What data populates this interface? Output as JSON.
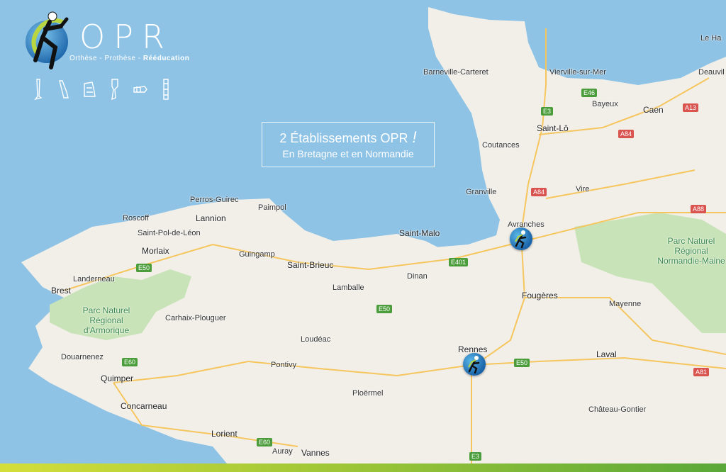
{
  "brand": {
    "name": "OPR",
    "tagline_regular": "Orthèse - Prothèse - ",
    "tagline_bold": "Rééducation",
    "icons": [
      "leg-prosthesis-icon",
      "arm-prosthesis-icon",
      "boot-orthosis-icon",
      "knee-prosthesis-icon",
      "hand-orthosis-icon",
      "splint-icon"
    ]
  },
  "callout": {
    "title": "2 Établissements OPR",
    "exclamation": "!",
    "subtitle": "En Bretagne et en Normandie"
  },
  "places": {
    "barneville": "Barneville-Carteret",
    "vierville": "Vierville-sur-Mer",
    "lehavre": "Le Ha",
    "deauville": "Deauvil",
    "bayeux": "Bayeux",
    "caen": "Caen",
    "saintlo": "Saint-Lô",
    "coutances": "Coutances",
    "granville": "Granville",
    "vire": "Vire",
    "avranches": "Avranches",
    "perros": "Perros-Guirec",
    "lannion": "Lannion",
    "paimpol": "Paimpol",
    "roscoff": "Roscoff",
    "stpol": "Saint-Pol-de-Léon",
    "morlaix": "Morlaix",
    "guingamp": "Guingamp",
    "saintmalo": "Saint-Malo",
    "saintbrieuc": "Saint-Brieuc",
    "landerneau": "Landerneau",
    "brest": "Brest",
    "lamballe": "Lamballe",
    "dinan": "Dinan",
    "fougeres": "Fougères",
    "mayenne": "Mayenne",
    "carhaix": "Carhaix-Plouguer",
    "loudeac": "Loudéac",
    "douarnenez": "Douarnenez",
    "rennes": "Rennes",
    "laval": "Laval",
    "quimper": "Quimper",
    "pontivy": "Pontivy",
    "ploermel": "Ploërmel",
    "concarneau": "Concarneau",
    "chateaugontier": "Château-Gontier",
    "lorient": "Lorient",
    "auray": "Auray",
    "vannes": "Vannes"
  },
  "parks": {
    "armorique": "Parc Naturel Régional d'Armorique",
    "normandie": "Parc Naturel Régional Normandie-Maine"
  },
  "roads": {
    "e46": "E46",
    "e3_north": "E3",
    "a13": "A13",
    "a84_a": "A84",
    "a84_b": "A84",
    "a88": "A88",
    "e50_a": "E50",
    "e401": "E401",
    "e50_b": "E50",
    "e60_a": "E60",
    "e50_c": "E50",
    "a81": "A81",
    "e60_b": "E60",
    "e3_south": "E3"
  },
  "markers": [
    "avranches-opr-marker",
    "rennes-opr-marker"
  ],
  "colors": {
    "sea": "#8ec3e6",
    "land": "#f2efe9",
    "park_green": "#c8e3b8",
    "brand_blue": "#1a63a8",
    "brand_green": "#9ac437"
  }
}
